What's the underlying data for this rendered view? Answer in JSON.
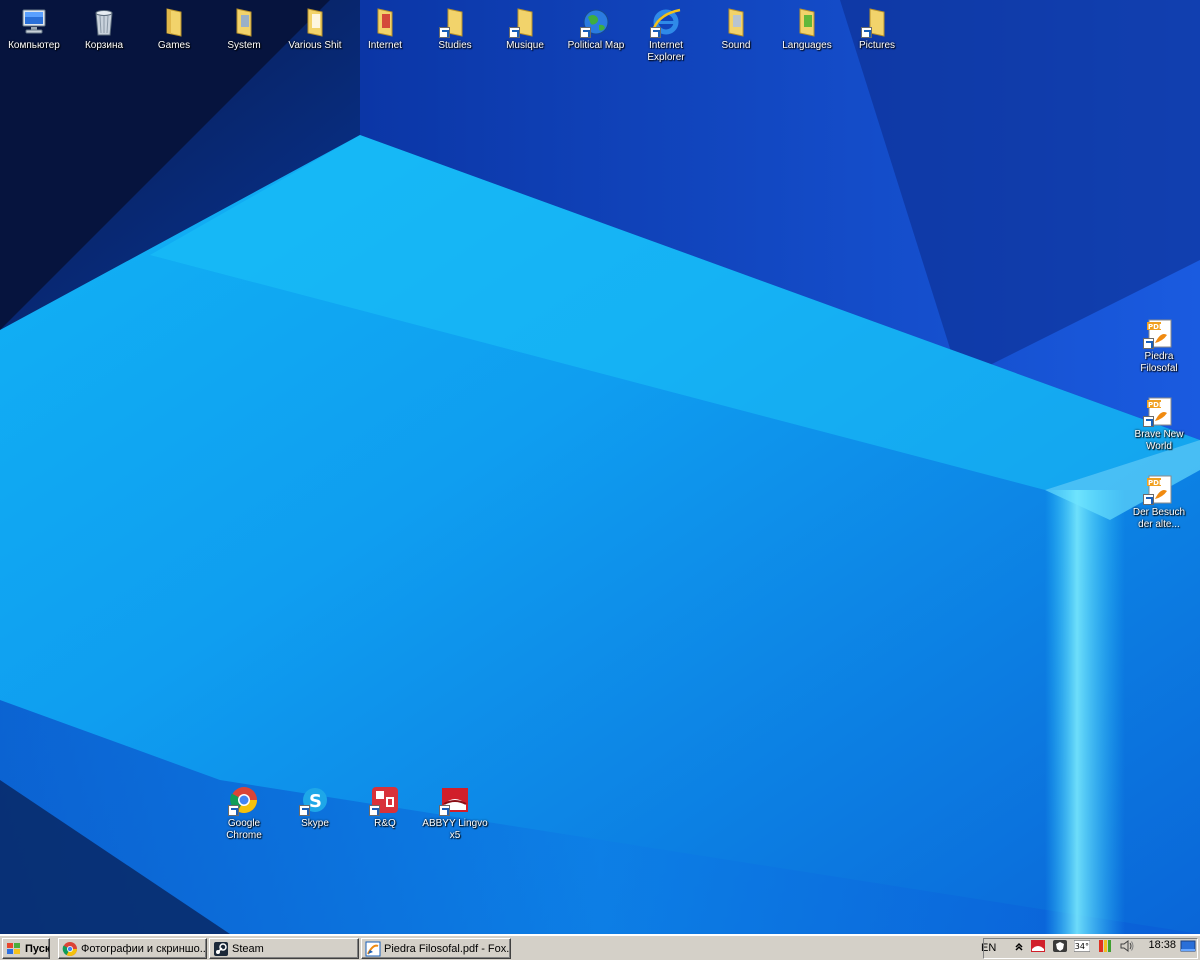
{
  "desktop": {
    "top_icons": [
      {
        "label": "Компьютер",
        "icon": "computer-icon"
      },
      {
        "label": "Корзина",
        "icon": "recycle-bin-icon"
      },
      {
        "label": "Games",
        "icon": "folder-icon"
      },
      {
        "label": "System",
        "icon": "folder-icon"
      },
      {
        "label": "Various Shit",
        "icon": "folder-icon"
      },
      {
        "label": "Internet",
        "icon": "folder-icon"
      },
      {
        "label": "Studies",
        "icon": "folder-icon"
      },
      {
        "label": "Musique",
        "icon": "folder-icon"
      },
      {
        "label": "Political Map",
        "icon": "globe-icon"
      },
      {
        "label": "Internet Explorer",
        "icon": "internet-explorer-icon"
      },
      {
        "label": "Sound",
        "icon": "folder-icon"
      },
      {
        "label": "Languages",
        "icon": "folder-icon"
      },
      {
        "label": "Pictures",
        "icon": "folder-icon"
      }
    ],
    "right_icons": [
      {
        "label": "Piedra Filosofal",
        "icon": "pdf-icon"
      },
      {
        "label": "Brave New World",
        "icon": "pdf-icon"
      },
      {
        "label": "Der Besuch der alte...",
        "icon": "pdf-icon"
      }
    ],
    "bottom_icons": [
      {
        "label": "Google Chrome",
        "icon": "chrome-icon"
      },
      {
        "label": "Skype",
        "icon": "skype-icon"
      },
      {
        "label": "R&Q",
        "icon": "rq-icon"
      },
      {
        "label": "ABBYY Lingvo x5",
        "icon": "abbyy-lingvo-icon"
      }
    ]
  },
  "taskbar": {
    "start_label": "Пуск",
    "tasks": [
      {
        "label": "Фотографии и скриншо...",
        "icon": "chrome-icon"
      },
      {
        "label": "Steam",
        "icon": "steam-icon"
      },
      {
        "label": "Piedra Filosofal.pdf - Fox...",
        "icon": "foxit-icon"
      }
    ],
    "tray": {
      "language": "EN",
      "temperature": "34°",
      "clock": "18:38"
    }
  }
}
